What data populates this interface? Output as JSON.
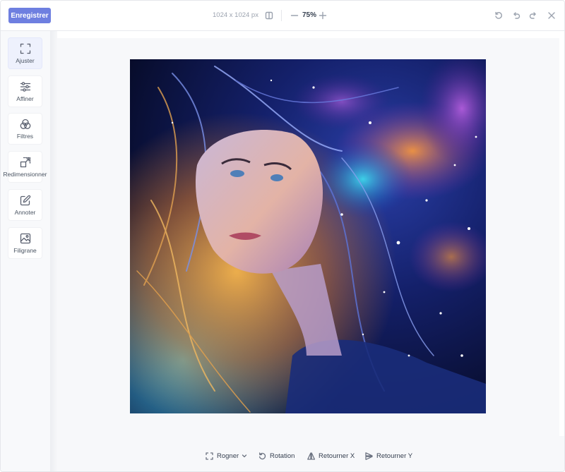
{
  "toolbar": {
    "save_label": "Enregistrer",
    "dimensions": "1024 x 1024 px",
    "zoom": "75%"
  },
  "sidebar": {
    "items": [
      {
        "label": "Ajuster",
        "icon": "fullscreen-icon",
        "active": true
      },
      {
        "label": "Affiner",
        "icon": "sliders-icon",
        "active": false
      },
      {
        "label": "Filtres",
        "icon": "filters-icon",
        "active": false
      },
      {
        "label": "Redimensionner",
        "icon": "resize-icon",
        "active": false
      },
      {
        "label": "Annoter",
        "icon": "edit-icon",
        "active": false
      },
      {
        "label": "Filigrane",
        "icon": "watermark-image-icon",
        "active": false
      }
    ]
  },
  "bottom": {
    "crop": "Rogner",
    "rotation": "Rotation",
    "flip_x": "Retourner X",
    "flip_y": "Retourner Y"
  },
  "colors": {
    "accent": "#6e7fe0",
    "active_bg": "#eef1fd"
  }
}
